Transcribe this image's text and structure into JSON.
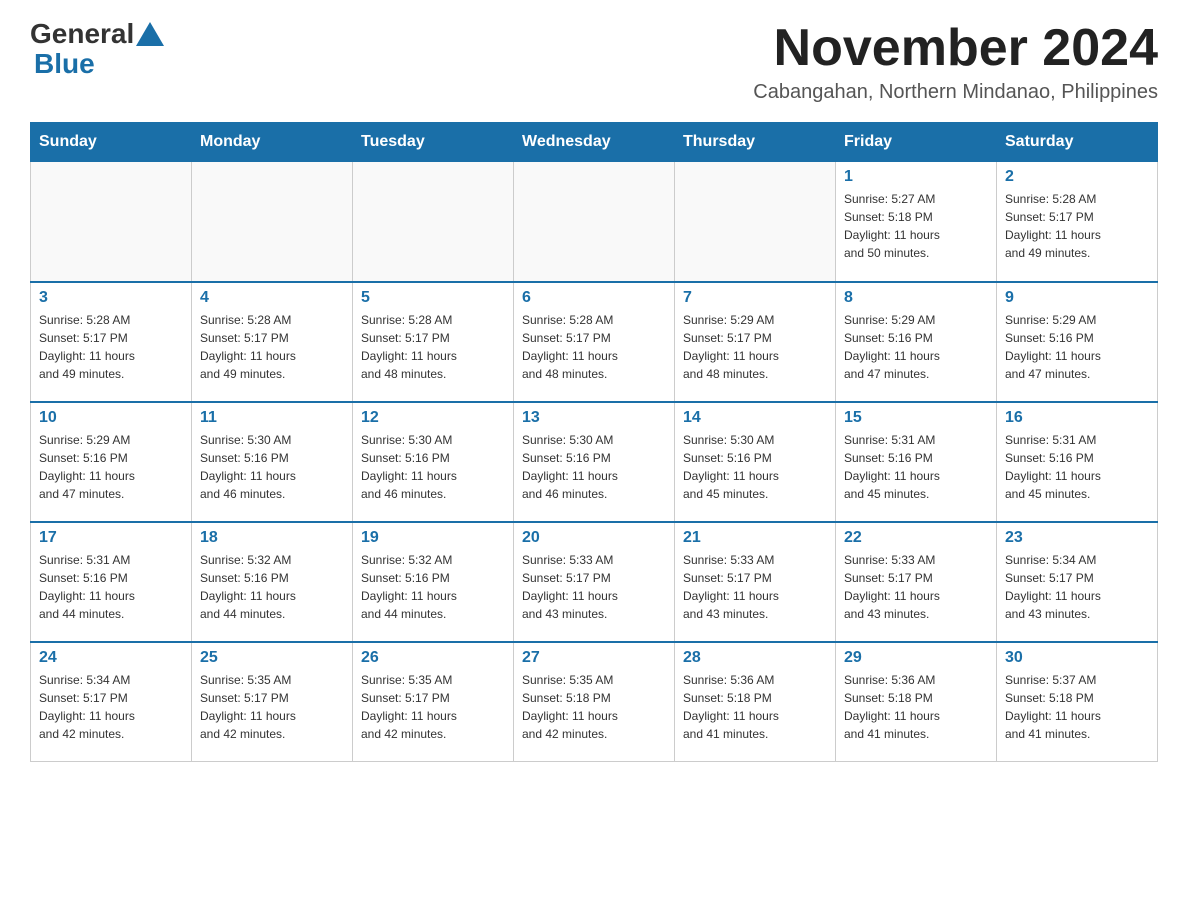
{
  "header": {
    "logo_general": "General",
    "logo_blue": "Blue",
    "month_title": "November 2024",
    "location": "Cabangahan, Northern Mindanao, Philippines"
  },
  "days_of_week": [
    "Sunday",
    "Monday",
    "Tuesday",
    "Wednesday",
    "Thursday",
    "Friday",
    "Saturday"
  ],
  "weeks": [
    [
      {
        "day": "",
        "info": ""
      },
      {
        "day": "",
        "info": ""
      },
      {
        "day": "",
        "info": ""
      },
      {
        "day": "",
        "info": ""
      },
      {
        "day": "",
        "info": ""
      },
      {
        "day": "1",
        "info": "Sunrise: 5:27 AM\nSunset: 5:18 PM\nDaylight: 11 hours\nand 50 minutes."
      },
      {
        "day": "2",
        "info": "Sunrise: 5:28 AM\nSunset: 5:17 PM\nDaylight: 11 hours\nand 49 minutes."
      }
    ],
    [
      {
        "day": "3",
        "info": "Sunrise: 5:28 AM\nSunset: 5:17 PM\nDaylight: 11 hours\nand 49 minutes."
      },
      {
        "day": "4",
        "info": "Sunrise: 5:28 AM\nSunset: 5:17 PM\nDaylight: 11 hours\nand 49 minutes."
      },
      {
        "day": "5",
        "info": "Sunrise: 5:28 AM\nSunset: 5:17 PM\nDaylight: 11 hours\nand 48 minutes."
      },
      {
        "day": "6",
        "info": "Sunrise: 5:28 AM\nSunset: 5:17 PM\nDaylight: 11 hours\nand 48 minutes."
      },
      {
        "day": "7",
        "info": "Sunrise: 5:29 AM\nSunset: 5:17 PM\nDaylight: 11 hours\nand 48 minutes."
      },
      {
        "day": "8",
        "info": "Sunrise: 5:29 AM\nSunset: 5:16 PM\nDaylight: 11 hours\nand 47 minutes."
      },
      {
        "day": "9",
        "info": "Sunrise: 5:29 AM\nSunset: 5:16 PM\nDaylight: 11 hours\nand 47 minutes."
      }
    ],
    [
      {
        "day": "10",
        "info": "Sunrise: 5:29 AM\nSunset: 5:16 PM\nDaylight: 11 hours\nand 47 minutes."
      },
      {
        "day": "11",
        "info": "Sunrise: 5:30 AM\nSunset: 5:16 PM\nDaylight: 11 hours\nand 46 minutes."
      },
      {
        "day": "12",
        "info": "Sunrise: 5:30 AM\nSunset: 5:16 PM\nDaylight: 11 hours\nand 46 minutes."
      },
      {
        "day": "13",
        "info": "Sunrise: 5:30 AM\nSunset: 5:16 PM\nDaylight: 11 hours\nand 46 minutes."
      },
      {
        "day": "14",
        "info": "Sunrise: 5:30 AM\nSunset: 5:16 PM\nDaylight: 11 hours\nand 45 minutes."
      },
      {
        "day": "15",
        "info": "Sunrise: 5:31 AM\nSunset: 5:16 PM\nDaylight: 11 hours\nand 45 minutes."
      },
      {
        "day": "16",
        "info": "Sunrise: 5:31 AM\nSunset: 5:16 PM\nDaylight: 11 hours\nand 45 minutes."
      }
    ],
    [
      {
        "day": "17",
        "info": "Sunrise: 5:31 AM\nSunset: 5:16 PM\nDaylight: 11 hours\nand 44 minutes."
      },
      {
        "day": "18",
        "info": "Sunrise: 5:32 AM\nSunset: 5:16 PM\nDaylight: 11 hours\nand 44 minutes."
      },
      {
        "day": "19",
        "info": "Sunrise: 5:32 AM\nSunset: 5:16 PM\nDaylight: 11 hours\nand 44 minutes."
      },
      {
        "day": "20",
        "info": "Sunrise: 5:33 AM\nSunset: 5:17 PM\nDaylight: 11 hours\nand 43 minutes."
      },
      {
        "day": "21",
        "info": "Sunrise: 5:33 AM\nSunset: 5:17 PM\nDaylight: 11 hours\nand 43 minutes."
      },
      {
        "day": "22",
        "info": "Sunrise: 5:33 AM\nSunset: 5:17 PM\nDaylight: 11 hours\nand 43 minutes."
      },
      {
        "day": "23",
        "info": "Sunrise: 5:34 AM\nSunset: 5:17 PM\nDaylight: 11 hours\nand 43 minutes."
      }
    ],
    [
      {
        "day": "24",
        "info": "Sunrise: 5:34 AM\nSunset: 5:17 PM\nDaylight: 11 hours\nand 42 minutes."
      },
      {
        "day": "25",
        "info": "Sunrise: 5:35 AM\nSunset: 5:17 PM\nDaylight: 11 hours\nand 42 minutes."
      },
      {
        "day": "26",
        "info": "Sunrise: 5:35 AM\nSunset: 5:17 PM\nDaylight: 11 hours\nand 42 minutes."
      },
      {
        "day": "27",
        "info": "Sunrise: 5:35 AM\nSunset: 5:18 PM\nDaylight: 11 hours\nand 42 minutes."
      },
      {
        "day": "28",
        "info": "Sunrise: 5:36 AM\nSunset: 5:18 PM\nDaylight: 11 hours\nand 41 minutes."
      },
      {
        "day": "29",
        "info": "Sunrise: 5:36 AM\nSunset: 5:18 PM\nDaylight: 11 hours\nand 41 minutes."
      },
      {
        "day": "30",
        "info": "Sunrise: 5:37 AM\nSunset: 5:18 PM\nDaylight: 11 hours\nand 41 minutes."
      }
    ]
  ],
  "accent_color": "#1a6fa8"
}
